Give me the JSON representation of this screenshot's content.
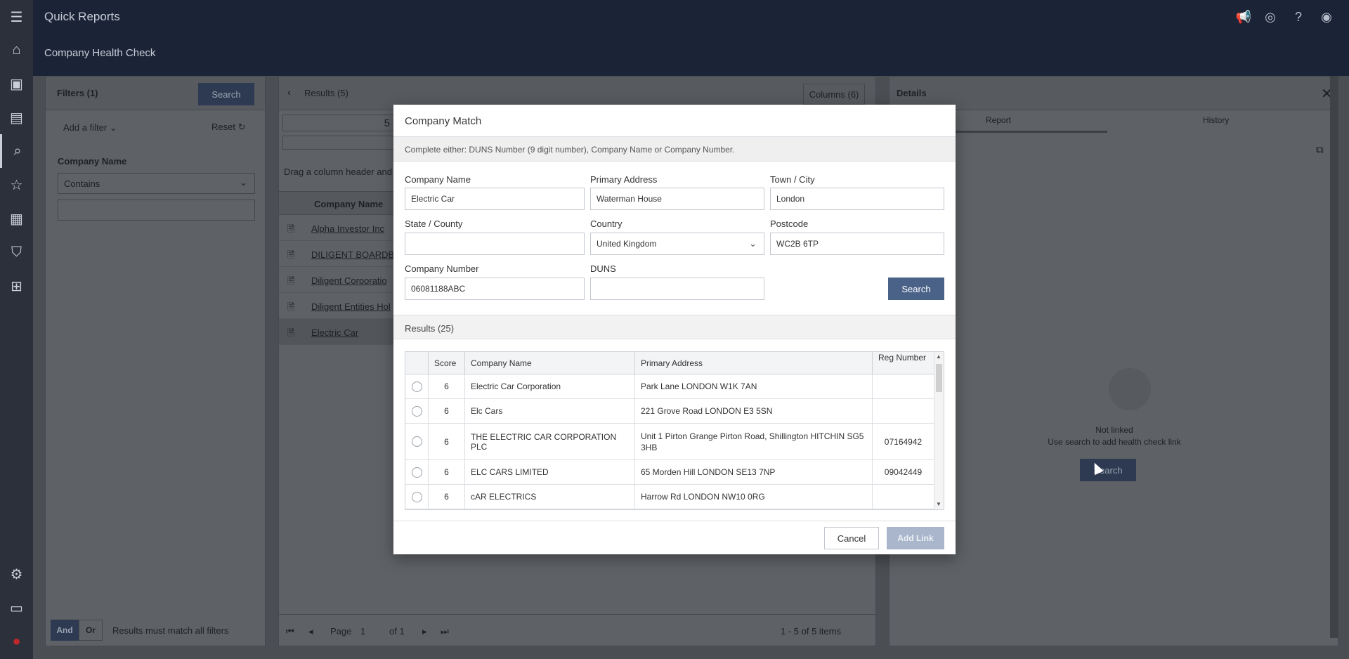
{
  "app": {
    "title": "Quick Reports",
    "subtitle": "Company Health Check"
  },
  "rail": {
    "icons": [
      "menu-icon",
      "home-icon",
      "contacts-icon",
      "layout-icon",
      "search-icon",
      "star-icon",
      "calendar-icon",
      "shield-icon",
      "org-chart-icon",
      "settings-icon",
      "archive-icon",
      "brand-logo-icon"
    ]
  },
  "filters": {
    "title": "Filters (1)",
    "search_label": "Search",
    "add_filter_label": "Add a filter",
    "reset_label": "Reset",
    "company_name_label": "Company Name",
    "condition_value": "Contains",
    "and_label": "And",
    "or_label": "Or",
    "match_text": "Results must match all filters"
  },
  "results": {
    "title": "Results (5)",
    "columns_label": "Columns (6)",
    "partial_value": "5",
    "drag_hint": "Drag a column header and",
    "column_header": "Company Name",
    "rows": [
      {
        "name": "Alpha Investor Inc"
      },
      {
        "name": "DILIGENT BOARDBO"
      },
      {
        "name": "Diligent Corporatio"
      },
      {
        "name": "Diligent Entities Hol"
      },
      {
        "name": "Electric Car"
      }
    ],
    "pager": {
      "page_label": "Page",
      "page": "1",
      "of": "of 1",
      "summary": "1 - 5 of 5 items"
    }
  },
  "details": {
    "title": "Details",
    "tabs": [
      "Report",
      "History"
    ],
    "not_linked": "Not linked",
    "use_search": "Use search to add health check link",
    "search_label": "Search"
  },
  "modal": {
    "title": "Company Match",
    "hint": "Complete either: DUNS Number (9 digit number), Company Name or Company Number.",
    "fields": {
      "company_name": {
        "label": "Company Name",
        "value": "Electric Car"
      },
      "primary_address": {
        "label": "Primary Address",
        "value": "Waterman House"
      },
      "town": {
        "label": "Town / City",
        "value": "London"
      },
      "state": {
        "label": "State / County",
        "value": ""
      },
      "country": {
        "label": "Country",
        "value": "United Kingdom"
      },
      "postcode": {
        "label": "Postcode",
        "value": "WC2B 6TP"
      },
      "company_number": {
        "label": "Company Number",
        "value": "06081188ABC"
      },
      "duns": {
        "label": "DUNS",
        "value": ""
      }
    },
    "search_label": "Search",
    "results_label": "Results (25)",
    "table": {
      "headers": [
        "",
        "Score",
        "Company Name",
        "Primary Address",
        "Reg Number"
      ],
      "rows": [
        {
          "score": "6",
          "name": "Electric Car Corporation",
          "address": "Park Lane LONDON W1K 7AN",
          "reg": ""
        },
        {
          "score": "6",
          "name": "Elc Cars",
          "address": "221 Grove Road LONDON E3 5SN",
          "reg": ""
        },
        {
          "score": "6",
          "name": "THE ELECTRIC CAR CORPORATION PLC",
          "address": "Unit 1 Pirton Grange Pirton Road, Shillington HITCHIN SG5 3HB",
          "reg": "07164942"
        },
        {
          "score": "6",
          "name": "ELC CARS LIMITED",
          "address": "65 Morden Hill LONDON SE13 7NP",
          "reg": "09042449"
        },
        {
          "score": "6",
          "name": "cAR ELECTRICS",
          "address": "Harrow Rd LONDON NW10 0RG",
          "reg": ""
        }
      ]
    },
    "cancel_label": "Cancel",
    "add_link_label": "Add Link"
  },
  "colors": {
    "header_bg": "#1b2437",
    "primary_button": "#4a6288",
    "disabled_button": "#a9b6cb"
  }
}
